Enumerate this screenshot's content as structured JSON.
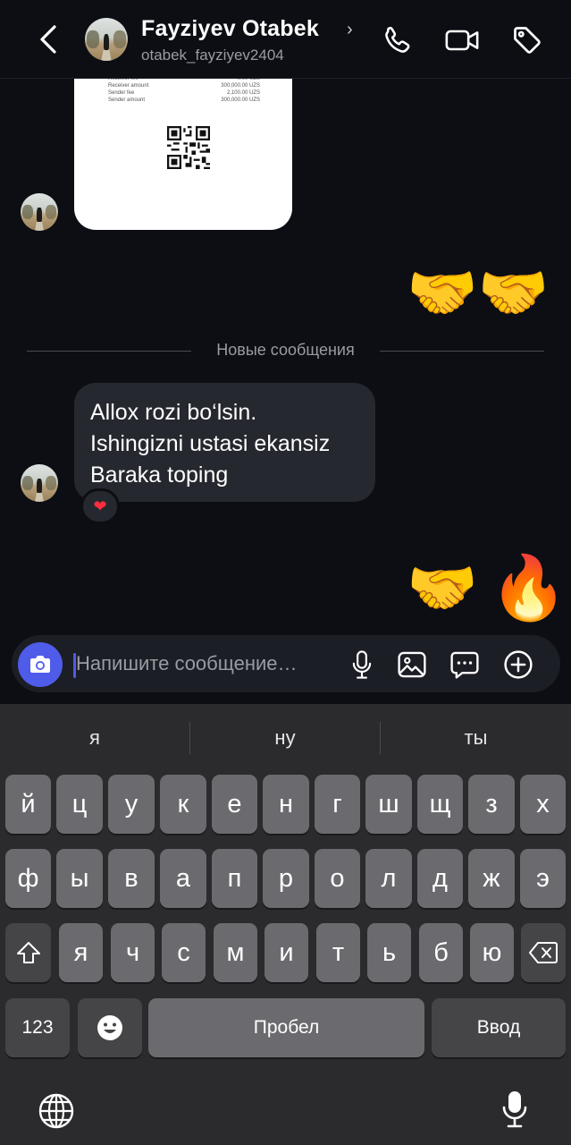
{
  "header": {
    "contact_name": "Fayziyev Otabek",
    "name_chevron": "›",
    "username": "otabek_fayziyev2404"
  },
  "receipt": {
    "rows": [
      {
        "label": "Receiver fee",
        "value": "0.00 UZS"
      },
      {
        "label": "Receiver amount",
        "value": "300,000.00 UZS"
      },
      {
        "label": "Sender fee",
        "value": "2,100.00 UZS"
      },
      {
        "label": "Sender amount",
        "value": "300,000.00 UZS"
      }
    ]
  },
  "messages": {
    "sent_1": "🤝🤝",
    "divider": "Новые сообщения",
    "received_lines": [
      "Allox rozi bo‘lsin.",
      "Ishingizni ustasi ekansiz",
      "Baraka toping"
    ],
    "reaction": "❤",
    "sent_2_a": "🤝",
    "sent_2_b": "🔥"
  },
  "composer": {
    "placeholder": "Напишите сообщение…"
  },
  "keyboard": {
    "suggestions": [
      "я",
      "ну",
      "ты"
    ],
    "row1": [
      "й",
      "ц",
      "у",
      "к",
      "е",
      "н",
      "г",
      "ш",
      "щ",
      "з",
      "х"
    ],
    "row2": [
      "ф",
      "ы",
      "в",
      "а",
      "п",
      "р",
      "о",
      "л",
      "д",
      "ж",
      "э"
    ],
    "row3": [
      "я",
      "ч",
      "с",
      "м",
      "и",
      "т",
      "ь",
      "б",
      "ю"
    ],
    "numbers_key": "123",
    "space_key": "Пробел",
    "enter_key": "Ввод"
  },
  "colors": {
    "background": "#0c0e14",
    "bubble": "#26282f",
    "accent": "#4e5ce9",
    "keyboard": "#2b2b2d"
  }
}
